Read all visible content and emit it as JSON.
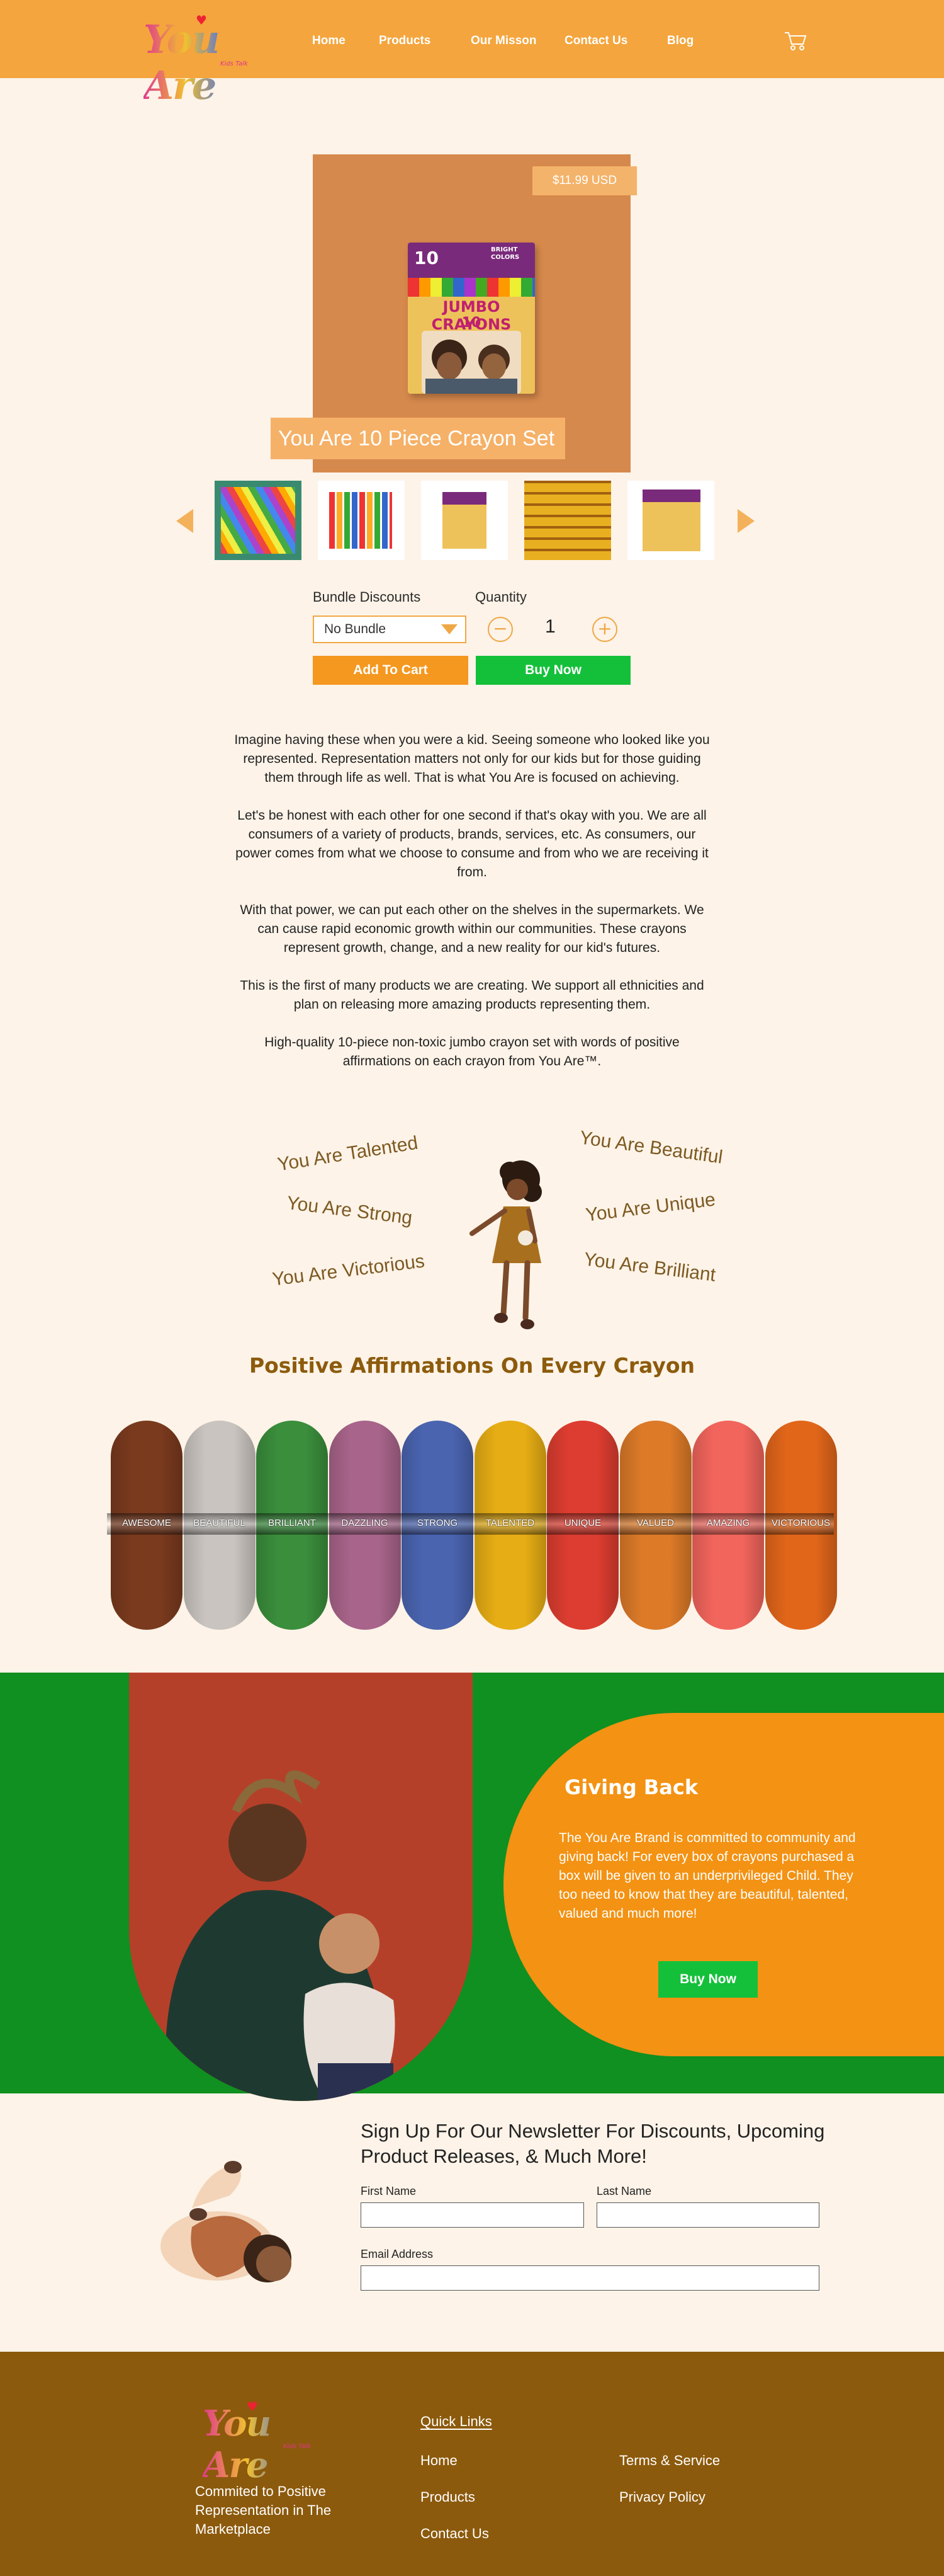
{
  "header": {
    "brand": "You Are",
    "tagline": "Kids Talk",
    "nav": [
      "Home",
      "Products",
      "Our Misson",
      "Contact Us",
      "Blog"
    ],
    "colors": {
      "header_bg": "#f4a53d",
      "accent": "#f49820",
      "buy": "#14c03a"
    }
  },
  "product": {
    "price": "$11.99 USD",
    "title": "You Are 10 Piece Crayon Set",
    "box_count": "10",
    "box_colors_label": "BRIGHT COLORS",
    "box_title": "JUMBO CRAYONS",
    "box_title_num": "10",
    "thumbnails": [
      "thumbnail-1",
      "thumbnail-2",
      "thumbnail-3",
      "thumbnail-4",
      "thumbnail-5"
    ]
  },
  "purchase": {
    "bundle_label": "Bundle Discounts",
    "bundle_selected": "No Bundle",
    "quantity_label": "Quantity",
    "quantity_value": "1",
    "minus": "−",
    "plus": "+",
    "add_to_cart": "Add To Cart",
    "buy_now": "Buy Now"
  },
  "description": [
    "Imagine having these when you were a kid. Seeing someone who looked like you represented. Representation matters not only for our kids but for those guiding them through life as well. That is what You Are is focused on achieving.",
    "Let's be honest with each other for one second if that's okay with you. We are all consumers of a variety of products, brands, services, etc. As consumers, our power comes from what we choose to consume and from who we are receiving it from.",
    "With that power, we can put each other on the shelves in the supermarkets. We can cause rapid economic growth within our communities. These crayons represent growth, change, and a new reality for our kid's futures.",
    "This is the first of many products we are creating. We support all ethnicities and plan on releasing more amazing products representing them.",
    "High-quality 10-piece non-toxic jumbo crayon set with words of positive affirmations on each crayon from You Are™."
  ],
  "affirmations": {
    "left": [
      "You Are Talented",
      "You Are Strong",
      "You Are Victorious"
    ],
    "right": [
      "You Are Beautiful",
      "You Are Unique",
      "You Are Brilliant"
    ],
    "title": "Positive Affirmations On Every Crayon"
  },
  "crayons": [
    {
      "label": "Awesome",
      "color": "#7a3a1e"
    },
    {
      "label": "Beautiful",
      "color": "#c9c4bf"
    },
    {
      "label": "Brilliant",
      "color": "#3a8e3c"
    },
    {
      "label": "Dazzling",
      "color": "#a8648a"
    },
    {
      "label": "Strong",
      "color": "#4a64b0"
    },
    {
      "label": "Talented",
      "color": "#e7ad14"
    },
    {
      "label": "Unique",
      "color": "#dd3d30"
    },
    {
      "label": "Valued",
      "color": "#dc7a28"
    },
    {
      "label": "Amazing",
      "color": "#f2655c"
    },
    {
      "label": "Victorious",
      "color": "#e2661a"
    }
  ],
  "giving": {
    "title": "Giving Back",
    "text": "The You Are Brand is committed to community and giving back! For every box of crayons purchased a box will be given to an underprivileged Child. They too need to know that they are beautiful, talented, valued and much more!",
    "button": "Buy Now"
  },
  "newsletter": {
    "title": "Sign Up For Our Newsletter For Discounts, Upcoming Product Releases, & Much More!",
    "first_name": "First Name",
    "last_name": "Last Name",
    "email": "Email Address"
  },
  "footer": {
    "tagline": "Commited to Positive Representation in The Marketplace",
    "quick_links": "Quick Links",
    "links_col1": [
      "Home",
      "Products",
      "Contact Us"
    ],
    "links_col2": [
      "Terms & Service",
      "Privacy Policy"
    ]
  }
}
